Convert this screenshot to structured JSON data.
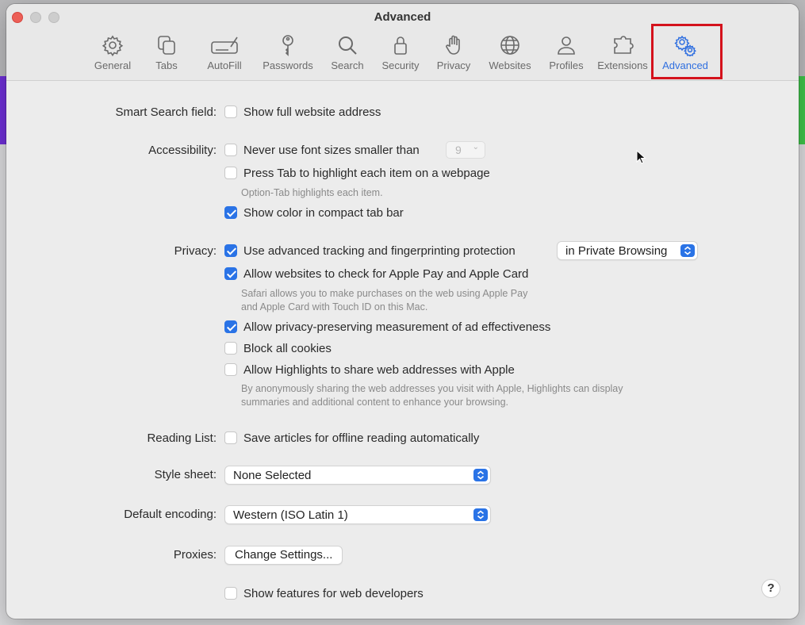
{
  "window": {
    "title": "Advanced"
  },
  "toolbar": {
    "tabs": [
      {
        "label": "General",
        "icon": "gear-icon"
      },
      {
        "label": "Tabs",
        "icon": "tabs-icon"
      },
      {
        "label": "AutoFill",
        "icon": "autofill-icon"
      },
      {
        "label": "Passwords",
        "icon": "key-icon"
      },
      {
        "label": "Search",
        "icon": "search-icon"
      },
      {
        "label": "Security",
        "icon": "lock-icon"
      },
      {
        "label": "Privacy",
        "icon": "hand-icon"
      },
      {
        "label": "Websites",
        "icon": "globe-icon"
      },
      {
        "label": "Profiles",
        "icon": "person-icon"
      },
      {
        "label": "Extensions",
        "icon": "puzzle-icon"
      },
      {
        "label": "Advanced",
        "icon": "gears-icon",
        "active": true
      }
    ]
  },
  "smart_search": {
    "label": "Smart Search field:",
    "show_full_address": {
      "text": "Show full website address",
      "checked": false
    }
  },
  "accessibility": {
    "label": "Accessibility:",
    "min_font": {
      "text": "Never use font sizes smaller than",
      "checked": false,
      "value": "9"
    },
    "press_tab": {
      "text": "Press Tab to highlight each item on a webpage",
      "checked": false,
      "note": "Option-Tab highlights each item."
    },
    "compact_color": {
      "text": "Show color in compact tab bar",
      "checked": true
    }
  },
  "privacy": {
    "label": "Privacy:",
    "tracking": {
      "text": "Use advanced tracking and fingerprinting protection",
      "checked": true,
      "mode": "in Private Browsing"
    },
    "apple_pay": {
      "text": "Allow websites to check for Apple Pay and Apple Card",
      "checked": true,
      "note_line1": "Safari allows you to make purchases on the web using Apple Pay",
      "note_line2": "and Apple Card with Touch ID on this Mac."
    },
    "ad_measure": {
      "text": "Allow privacy-preserving measurement of ad effectiveness",
      "checked": true
    },
    "block_cookies": {
      "text": "Block all cookies",
      "checked": false
    },
    "highlights": {
      "text": "Allow Highlights to share web addresses with Apple",
      "checked": false,
      "note_line1": "By anonymously sharing the web addresses you visit with Apple, Highlights can display",
      "note_line2": "summaries and additional content to enhance your browsing."
    }
  },
  "reading_list": {
    "label": "Reading List:",
    "offline": {
      "text": "Save articles for offline reading automatically",
      "checked": false
    }
  },
  "style_sheet": {
    "label": "Style sheet:",
    "value": "None Selected"
  },
  "encoding": {
    "label": "Default encoding:",
    "value": "Western (ISO Latin 1)"
  },
  "proxies": {
    "label": "Proxies:",
    "button": "Change Settings..."
  },
  "developer": {
    "text": "Show features for web developers",
    "checked": false
  },
  "help": {
    "label": "?"
  },
  "colors": {
    "accent": "#2a73e6",
    "highlight_box": "#d4121c"
  }
}
